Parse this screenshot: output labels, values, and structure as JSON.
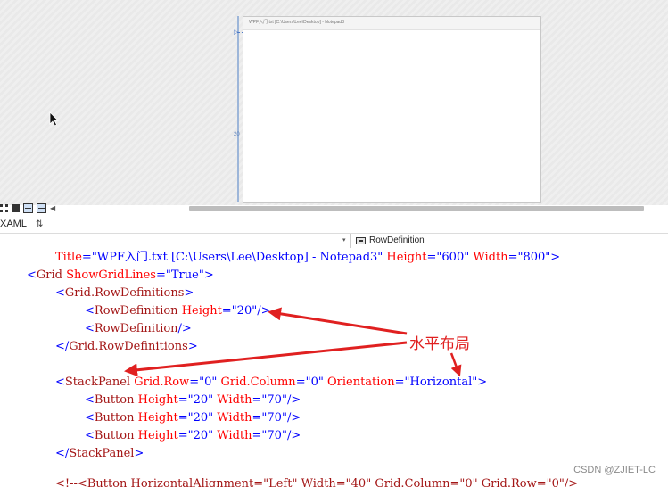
{
  "designer": {
    "window_title": "WPF入门.txt [C:\\Users\\Lee\\Desktop] - Notepad3",
    "row_marker": "20"
  },
  "tabs": {
    "xaml_label": "XAML"
  },
  "navbar": {
    "breadcrumb_label": "RowDefinition"
  },
  "code": {
    "line1": {
      "t1": "Title",
      "t2": "=",
      "t3": "\"WPF入门.txt [C:\\Users\\Lee\\Desktop] - Notepad3\"",
      "t4": "Height",
      "t5": "=",
      "t6": "\"600\"",
      "t7": "Width",
      "t8": "=",
      "t9": "\"800\"",
      "t10": ">"
    },
    "line2": {
      "t1": "<",
      "t2": "Grid",
      "t3": "ShowGridLines",
      "t4": "=",
      "t5": "\"True\"",
      "t6": ">"
    },
    "line3": {
      "t1": "<",
      "t2": "Grid.RowDefinitions",
      "t3": ">"
    },
    "line4": {
      "t1": "<",
      "t2": "RowDefinition",
      "t3": "Height",
      "t4": "=",
      "t5": "\"20\"",
      "t6": "/>"
    },
    "line5": {
      "t1": "<",
      "t2": "RowDefinition",
      "t3": "/>"
    },
    "line6": {
      "t1": "</",
      "t2": "Grid.RowDefinitions",
      "t3": ">"
    },
    "line7": {
      "t1": "<",
      "t2": "StackPanel",
      "t3": "Grid.Row",
      "t4": "=",
      "t5": "\"0\"",
      "t6": "Grid.Column",
      "t7": "=",
      "t8": "\"0\"",
      "t9": "Orientation",
      "t10": "=",
      "t11": "\"Horizontal\"",
      "t12": ">"
    },
    "button_line": {
      "t1": "<",
      "t2": "Button",
      "t3": "Height",
      "t4": "=",
      "t5": "\"20\"",
      "t6": "Width",
      "t7": "=",
      "t8": "\"70\"",
      "t9": "/>"
    },
    "line11": {
      "t1": "</",
      "t2": "StackPanel",
      "t3": ">"
    },
    "partial": "<!--<Button HorizontalAlignment=\"Left\" Width=\"40\" Grid.Column=\"0\" Grid.Row=\"0\"/>"
  },
  "annotation": {
    "text": "水平布局",
    "color": "#e02020"
  },
  "watermark": "CSDN @ZJIET-LC",
  "colors": {
    "bracket": "#0000ff",
    "element": "#a31515",
    "attribute": "#ff0000",
    "value": "#0000ff"
  }
}
